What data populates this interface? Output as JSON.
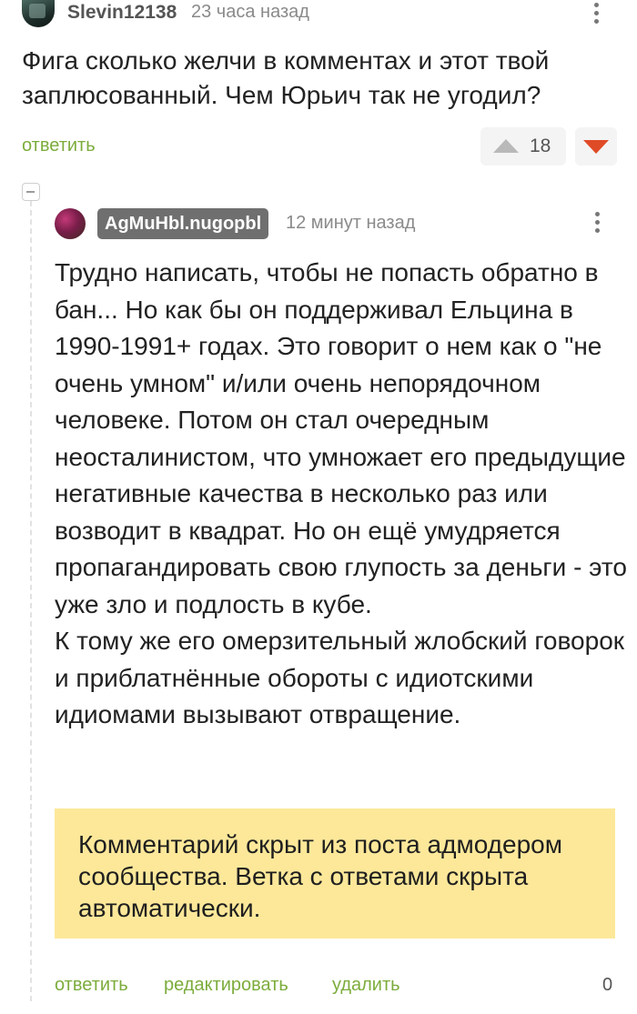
{
  "comment": {
    "author": "Slevin12138",
    "time": "23 часа назад",
    "text": "Фига сколько желчи в комментах и этот твой заплюсованный. Чем Юрьич так не угодил?",
    "reply_label": "ответить",
    "rating": "18"
  },
  "reply": {
    "author": "AgMuHbl.nugopbl",
    "time": "12 минут назад",
    "paragraphs": [
      "Трудно написать, чтобы не попасть обратно в бан... Но как бы он поддерживал Ельцина в 1990-1991+ годах. Это говорит о нем как о \"не очень умном\" и/или очень непорядочном человеке. Потом он стал очередным неосталинистом, что умножает его предыдущие негативные качества в несколько раз или возводит в квадрат. Но он ещё умудряется пропагандировать свою глупость за деньги - это уже зло и подлость в кубе.",
      "К тому же его омерзительный жлобский говорок и приблатнённые обороты с идиотскими идиомами вызывают отвращение."
    ],
    "hidden_notice": "Комментарий скрыт из поста адмодером сообщества. Ветка с ответами скрыта автоматически.",
    "actions": {
      "reply": "ответить",
      "edit": "редактировать",
      "delete": "удалить"
    },
    "score": "0"
  },
  "colors": {
    "link_green": "#7cac3c",
    "downvote_red": "#e04b27",
    "notice_yellow": "#fde89a"
  },
  "icons": {
    "upvote": "triangle-up-icon",
    "downvote": "triangle-down-icon",
    "menu": "kebab-menu-icon",
    "collapse": "collapse-minus-icon"
  }
}
